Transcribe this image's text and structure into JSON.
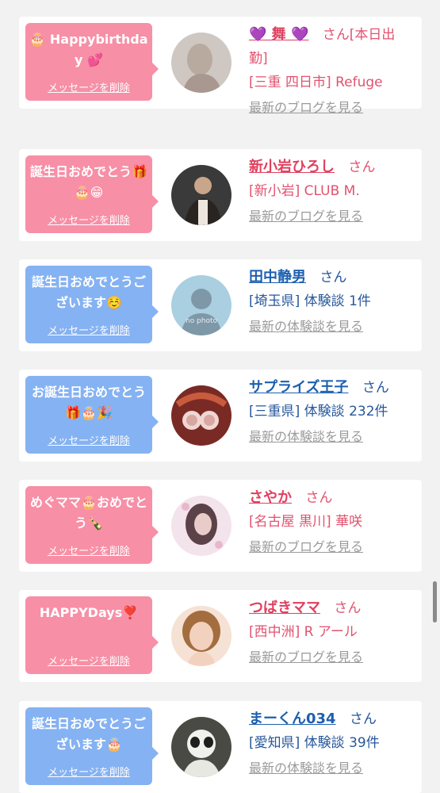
{
  "delete_label": "メッセージを削除",
  "entries": [
    {
      "theme": "pink",
      "message": "🎂 Happybirthday 💕",
      "name": "💜 舞 💜",
      "honorific": "さん",
      "name_suffix": "[本日出勤]",
      "detail": "[三重 四日市] Refuge",
      "link": "最新のブログを見る"
    },
    {
      "theme": "pink",
      "message": "誕生日おめでとう🎁🎂😁",
      "name": "新小岩ひろし",
      "honorific": "さん",
      "name_suffix": "",
      "detail": "[新小岩] CLUB M.",
      "link": "最新のブログを見る"
    },
    {
      "theme": "blue",
      "message": "誕生日おめでとうございます☺️",
      "name": "田中静男",
      "honorific": "さん",
      "name_suffix": "",
      "detail": "[埼玉県] 体験談 1件",
      "link": "最新の体験談を見る",
      "avatar_text": "no photo"
    },
    {
      "theme": "blue",
      "message": "お誕生日おめでとう🎁🎂🎉",
      "name": "サプライズ王子",
      "honorific": "さん",
      "name_suffix": "",
      "detail": "[三重県] 体験談 232件",
      "link": "最新の体験談を見る"
    },
    {
      "theme": "pink",
      "message": "めぐママ🎂おめでとう🍾",
      "name": "さやか",
      "honorific": "さん",
      "name_suffix": "",
      "detail": "[名古屋 黒川] 華咲",
      "link": "最新のブログを見る"
    },
    {
      "theme": "pink",
      "message": "HAPPYDays❣️",
      "name": "つばきママ",
      "honorific": "さん",
      "name_suffix": "",
      "detail": "[西中洲] R アール",
      "link": "最新のブログを見る"
    },
    {
      "theme": "blue",
      "message": "誕生日おめでとうございます🎂",
      "name": "まーくん034",
      "honorific": "さん",
      "name_suffix": "",
      "detail": "[愛知県] 体験談 39件",
      "link": "最新の体験談を見る"
    }
  ]
}
